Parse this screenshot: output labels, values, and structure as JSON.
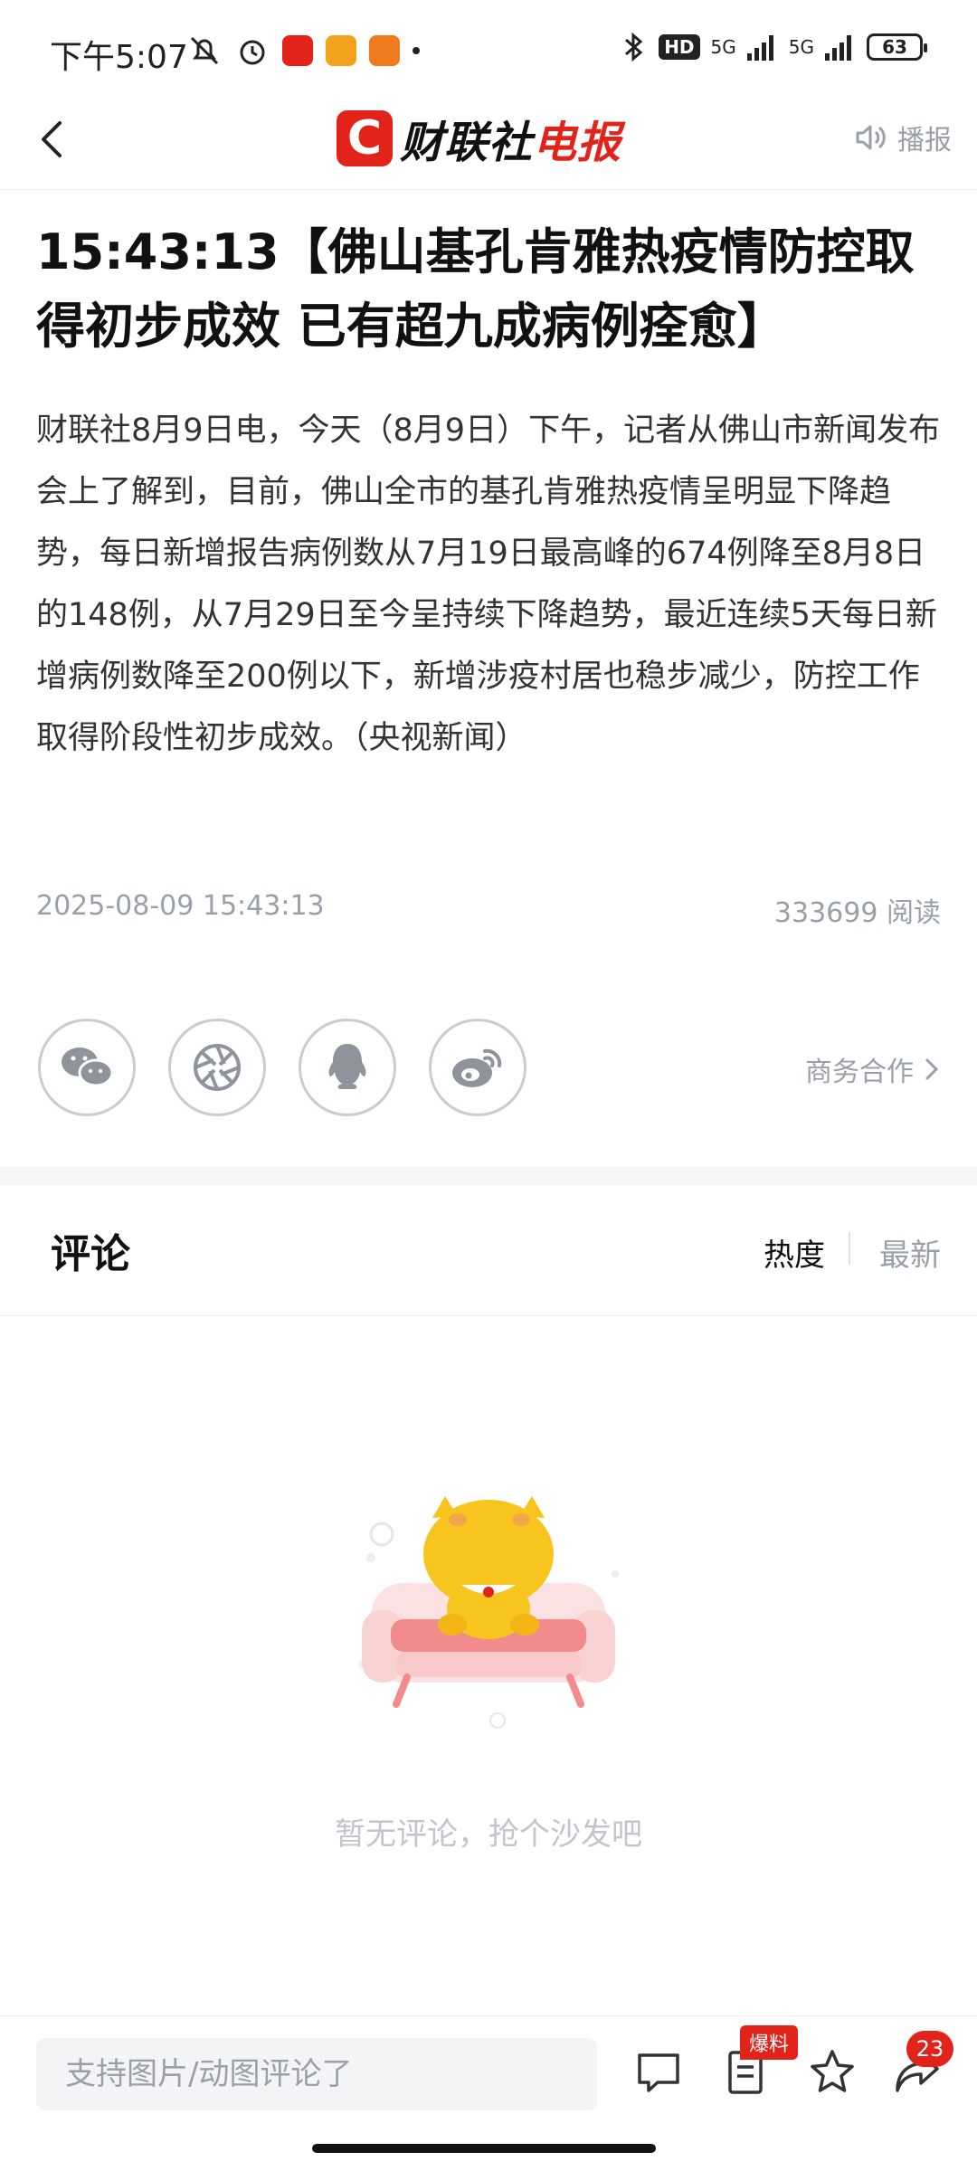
{
  "status_bar": {
    "time": "下午5:07",
    "network_1": "5G",
    "network_2": "5G",
    "hd_label": "HD",
    "battery": "63"
  },
  "header": {
    "logo_letter": "C",
    "logo_brand": "财联社",
    "logo_suffix": "电报",
    "broadcast_label": "播报"
  },
  "article": {
    "headline": "15:43:13【佛山基孔肯雅热疫情防控取得初步成效 已有超九成病例痊愈】",
    "body": "财联社8月9日电，今天（8月9日）下午，记者从佛山市新闻发布会上了解到，目前，佛山全市的基孔肯雅热疫情呈明显下降趋势，每日新增报告病例数从7月19日最高峰的674例降至8月8日的148例，从7月29日至今呈持续下降趋势，最近连续5天每日新增病例数降至200例以下，新增涉疫村居也稳步减少，防控工作取得阶段性初步成效。（央视新闻）",
    "date": "2025-08-09 15:43:13",
    "read_count": "333699",
    "read_label": "阅读"
  },
  "share": {
    "items": [
      "wechat-icon",
      "moments-icon",
      "qq-icon",
      "weibo-icon"
    ],
    "business_label": "商务合作"
  },
  "comments": {
    "title": "评论",
    "sort_hot": "热度",
    "sort_new": "最新",
    "empty_text": "暂无评论，抢个沙发吧"
  },
  "bottom_bar": {
    "input_placeholder": "支持图片/动图评论了",
    "baoliao_badge": "爆料",
    "share_count": "23"
  },
  "colors": {
    "brand_red": "#e2231a",
    "muted_gray": "#9aa0aa"
  }
}
